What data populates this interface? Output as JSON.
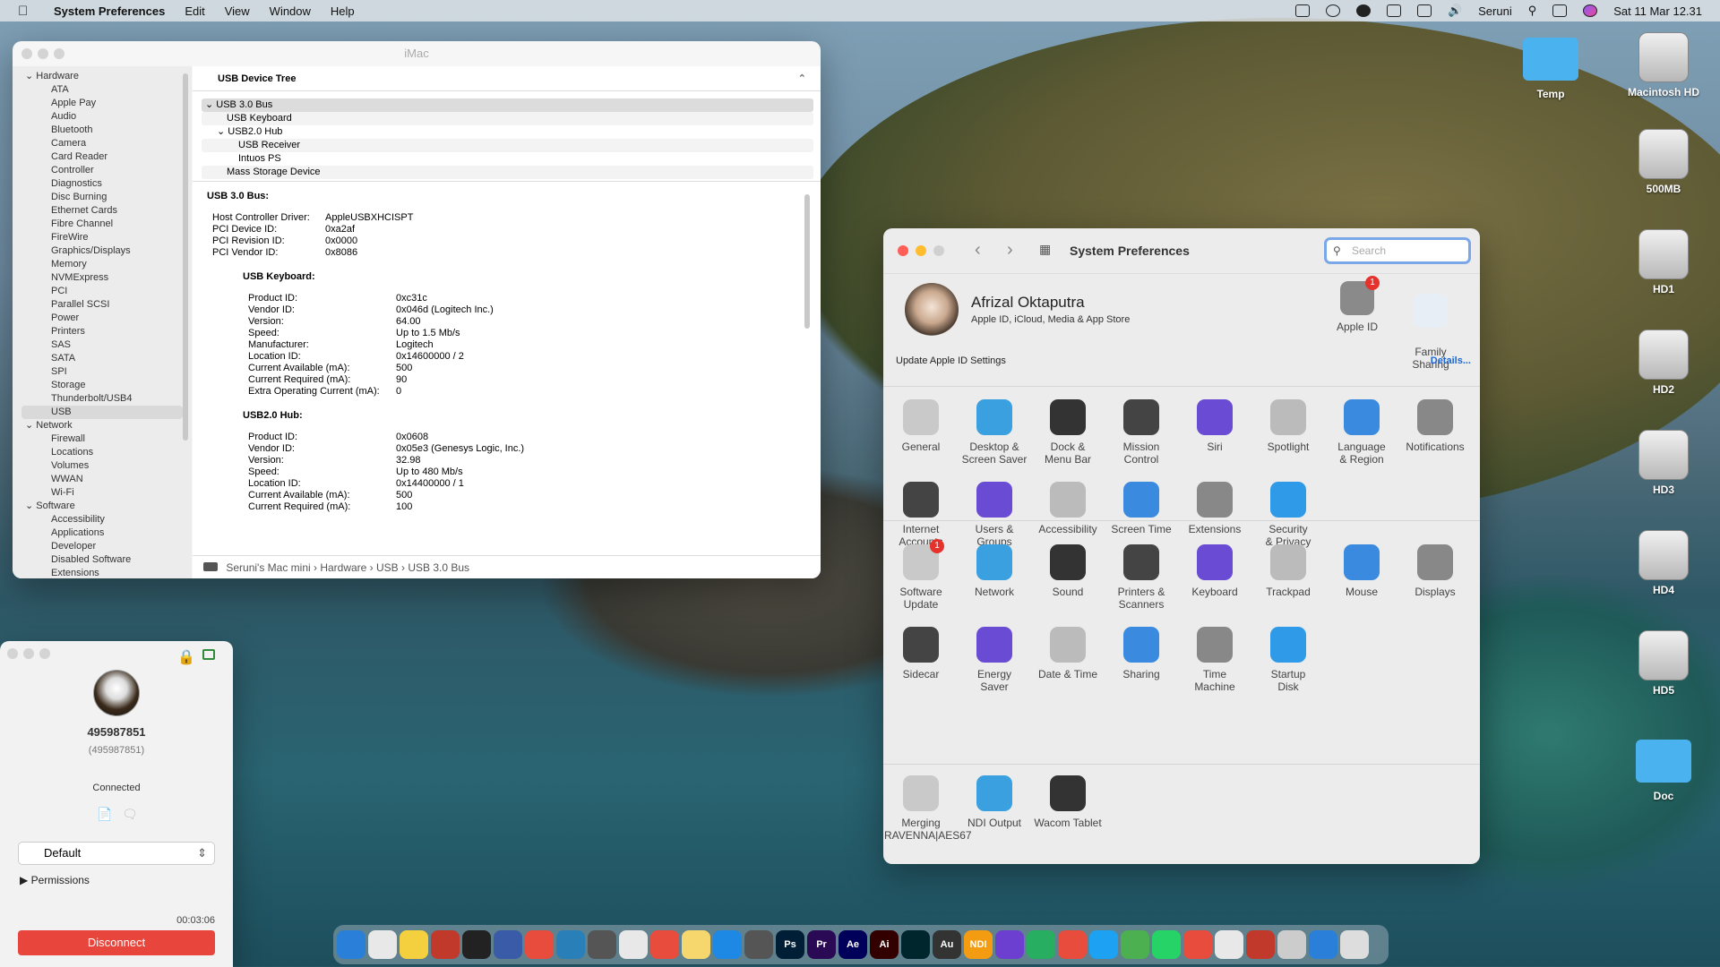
{
  "menubar": {
    "apple": "",
    "app": "System Preferences",
    "menus": [
      "Edit",
      "View",
      "Window",
      "Help"
    ],
    "user": "Seruni",
    "datetime": "Sat 11 Mar  12.31"
  },
  "sysinfo": {
    "title": "iMac",
    "sidebar": [
      {
        "type": "grp",
        "label": "Hardware"
      },
      {
        "type": "itm",
        "label": "ATA"
      },
      {
        "type": "itm",
        "label": "Apple Pay"
      },
      {
        "type": "itm",
        "label": "Audio"
      },
      {
        "type": "itm",
        "label": "Bluetooth"
      },
      {
        "type": "itm",
        "label": "Camera"
      },
      {
        "type": "itm",
        "label": "Card Reader"
      },
      {
        "type": "itm",
        "label": "Controller"
      },
      {
        "type": "itm",
        "label": "Diagnostics"
      },
      {
        "type": "itm",
        "label": "Disc Burning"
      },
      {
        "type": "itm",
        "label": "Ethernet Cards"
      },
      {
        "type": "itm",
        "label": "Fibre Channel"
      },
      {
        "type": "itm",
        "label": "FireWire"
      },
      {
        "type": "itm",
        "label": "Graphics/Displays"
      },
      {
        "type": "itm",
        "label": "Memory"
      },
      {
        "type": "itm",
        "label": "NVMExpress"
      },
      {
        "type": "itm",
        "label": "PCI"
      },
      {
        "type": "itm",
        "label": "Parallel SCSI"
      },
      {
        "type": "itm",
        "label": "Power"
      },
      {
        "type": "itm",
        "label": "Printers"
      },
      {
        "type": "itm",
        "label": "SAS"
      },
      {
        "type": "itm",
        "label": "SATA"
      },
      {
        "type": "itm",
        "label": "SPI"
      },
      {
        "type": "itm",
        "label": "Storage"
      },
      {
        "type": "itm",
        "label": "Thunderbolt/USB4"
      },
      {
        "type": "sel",
        "label": "USB"
      },
      {
        "type": "grp",
        "label": "Network"
      },
      {
        "type": "itm",
        "label": "Firewall"
      },
      {
        "type": "itm",
        "label": "Locations"
      },
      {
        "type": "itm",
        "label": "Volumes"
      },
      {
        "type": "itm",
        "label": "WWAN"
      },
      {
        "type": "itm",
        "label": "Wi-Fi"
      },
      {
        "type": "grp",
        "label": "Software"
      },
      {
        "type": "itm",
        "label": "Accessibility"
      },
      {
        "type": "itm",
        "label": "Applications"
      },
      {
        "type": "itm",
        "label": "Developer"
      },
      {
        "type": "itm",
        "label": "Disabled Software"
      },
      {
        "type": "itm",
        "label": "Extensions"
      }
    ],
    "tree_header": "USB Device Tree",
    "tree": [
      {
        "label": "USB 3.0 Bus",
        "depth": 0,
        "arrow": "⌄",
        "selected": true
      },
      {
        "label": "USB Keyboard",
        "depth": 1,
        "arrow": ""
      },
      {
        "label": "USB2.0 Hub",
        "depth": 1,
        "arrow": "⌄"
      },
      {
        "label": "USB Receiver",
        "depth": 2,
        "arrow": ""
      },
      {
        "label": "Intuos PS",
        "depth": 2,
        "arrow": ""
      },
      {
        "label": "Mass Storage Device",
        "depth": 1,
        "arrow": ""
      }
    ],
    "detail": {
      "heading": "USB 3.0 Bus:",
      "bus": [
        [
          "Host Controller Driver:",
          "AppleUSBXHCISPT"
        ],
        [
          "PCI Device ID:",
          "0xa2af"
        ],
        [
          "PCI Revision ID:",
          "0x0000"
        ],
        [
          "PCI Vendor ID:",
          "0x8086"
        ]
      ],
      "kbd_heading": "USB Keyboard:",
      "kbd": [
        [
          "Product ID:",
          "0xc31c"
        ],
        [
          "Vendor ID:",
          "0x046d  (Logitech Inc.)"
        ],
        [
          "Version:",
          "64.00"
        ],
        [
          "Speed:",
          "Up to 1.5 Mb/s"
        ],
        [
          "Manufacturer:",
          "Logitech"
        ],
        [
          "Location ID:",
          "0x14600000 / 2"
        ],
        [
          "Current Available (mA):",
          "500"
        ],
        [
          "Current Required (mA):",
          "90"
        ],
        [
          "Extra Operating Current (mA):",
          "0"
        ]
      ],
      "hub_heading": "USB2.0 Hub:",
      "hub": [
        [
          "Product ID:",
          "0x0608"
        ],
        [
          "Vendor ID:",
          "0x05e3  (Genesys Logic, Inc.)"
        ],
        [
          "Version:",
          "32.98"
        ],
        [
          "Speed:",
          "Up to 480 Mb/s"
        ],
        [
          "Location ID:",
          "0x14400000 / 1"
        ],
        [
          "Current Available (mA):",
          "500"
        ],
        [
          "Current Required (mA):",
          "100"
        ]
      ]
    },
    "path": "Seruni's Mac mini  ›  Hardware  ›  USB  ›  USB 3.0 Bus"
  },
  "remote": {
    "id": "495987851",
    "id_sub": "(495987851)",
    "status": "Connected",
    "profile": "Default",
    "permissions": "Permissions",
    "timer": "00:03:06",
    "disconnect": "Disconnect",
    "accent": "#e8453c"
  },
  "prefs": {
    "title": "System Preferences",
    "search_placeholder": "Search",
    "user_name": "Afrizal Oktaputra",
    "user_sub": "Apple ID, iCloud, Media & App Store",
    "apple_id": "Apple ID",
    "apple_id_badge": "1",
    "family": "Family\nSharing",
    "update_text": "Update Apple ID Settings",
    "details": "Details...",
    "row1": [
      "General",
      "Desktop &\nScreen Saver",
      "Dock &\nMenu Bar",
      "Mission\nControl",
      "Siri",
      "Spotlight",
      "Language\n& Region",
      "Notifications"
    ],
    "row2": [
      "Internet\nAccounts",
      "Users &\nGroups",
      "Accessibility",
      "Screen Time",
      "Extensions",
      "Security\n& Privacy"
    ],
    "row3": [
      "Software\nUpdate",
      "Network",
      "Sound",
      "Printers &\nScanners",
      "Keyboard",
      "Trackpad",
      "Mouse",
      "Displays"
    ],
    "row4": [
      "Sidecar",
      "Energy\nSaver",
      "Date & Time",
      "Sharing",
      "Time\nMachine",
      "Startup\nDisk"
    ],
    "row5": [
      "Merging\nRAVENNA|AES67",
      "NDI Output",
      "Wacom Tablet"
    ],
    "software_update_badge": "1"
  },
  "desktop": [
    {
      "label": "Temp",
      "kind": "folder"
    },
    {
      "label": "Macintosh HD",
      "kind": "disk"
    },
    {
      "label": "500MB",
      "kind": "disk"
    },
    {
      "label": "HD1",
      "kind": "disk"
    },
    {
      "label": "HD2",
      "kind": "disk"
    },
    {
      "label": "HD3",
      "kind": "disk"
    },
    {
      "label": "HD4",
      "kind": "disk"
    },
    {
      "label": "HD5",
      "kind": "disk"
    },
    {
      "label": "Doc",
      "kind": "folder"
    }
  ],
  "dock": [
    "Ps",
    "Pr",
    "Ae",
    "Ai",
    "Au",
    "NDI"
  ]
}
